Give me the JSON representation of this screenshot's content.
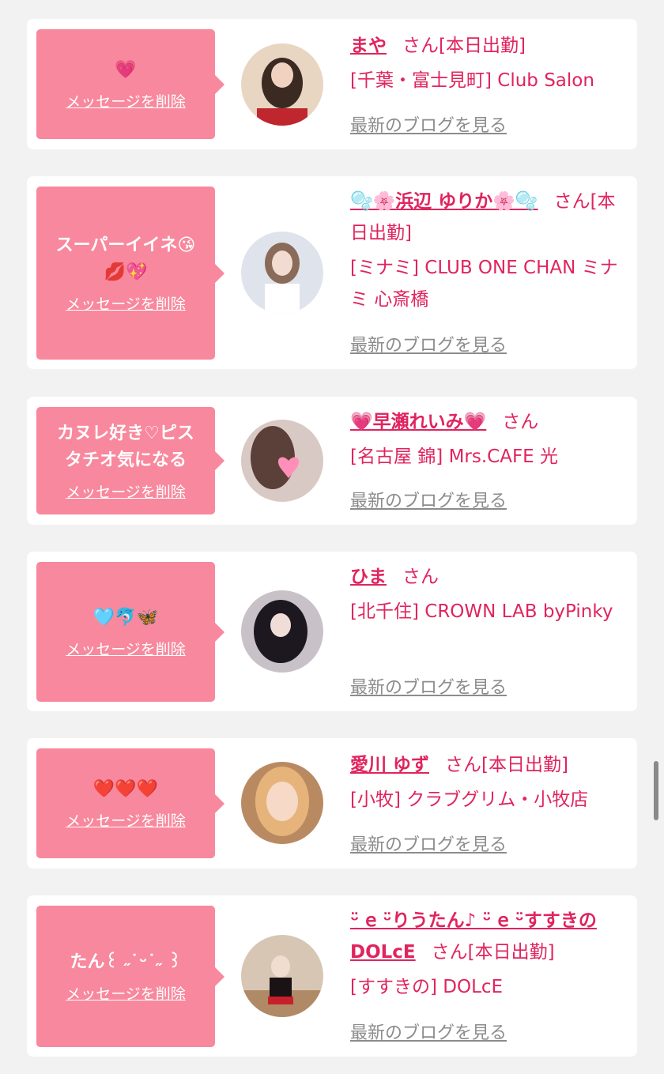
{
  "common": {
    "delete_label": "メッセージを削除",
    "blog_label": "最新のブログを見る",
    "san_label": "さん"
  },
  "cards": [
    {
      "message": "💗",
      "name": "まや",
      "status": "[本日出勤]",
      "store": "[千葉・富士見町] Club Salon"
    },
    {
      "message": "スーパーイイネ😘\n💋💖",
      "name": "🫧🌸浜辺 ゆりか🌸🫧",
      "status": "[本日出勤]",
      "store": "[ミナミ] CLUB ONE CHAN ミナミ 心斎橋"
    },
    {
      "message": "カヌレ好き♡ピス\nタチオ気になる",
      "name": "💗早瀬れいみ💗",
      "status": "",
      "store": "[名古屋 錦] Mrs.CAFE 光"
    },
    {
      "message": "🩵🐬🦋",
      "name": "ひま",
      "status": "",
      "store": "[北千住] CROWN LAB byPinky"
    },
    {
      "message": "❤️❤️❤️",
      "name": "愛川 ゆず",
      "status": "[本日出勤]",
      "store": "[小牧] クラブグリム・小牧店"
    },
    {
      "message": "たん꒰ ˶˙ᵕ˙˶ ꒱",
      "name": "ᵕ̈ 𝖾 ᵕ̈りうたん♪ ᵕ̈ 𝖾 ᵕ̈すすきのDOLcE",
      "status": "[本日出勤]",
      "store": "[すすきの] DOLcE"
    }
  ]
}
